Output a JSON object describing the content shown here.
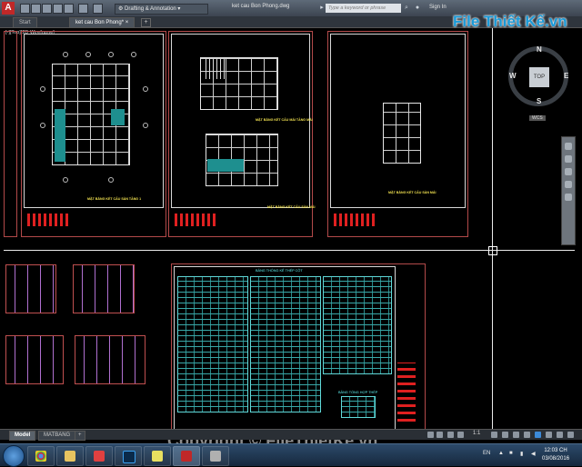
{
  "titlebar": {
    "app_logo": "A",
    "workspace": "Drafting & Annotation",
    "document_title": "ket cau Bon Phong.dwg",
    "search_placeholder": "Type a keyword or phrase",
    "sign_in": "Sign In"
  },
  "file_tabs": [
    {
      "label": "Start"
    },
    {
      "label": "ket cau Bon Phong*"
    }
  ],
  "viewport": {
    "label": "[-][Top][2D Wireframe]"
  },
  "drawings": {
    "caption_1": "MẶT BẰNG KẾT CẤU SÀN TẦNG 1",
    "caption_2a": "MẶT BẰNG KẾT CẤU MÁI TẦNG MÁI",
    "caption_2b": "MẶT BẰNG KẾT CẤU SÀN MÁI",
    "caption_3": "MẶT BẰNG KẾT CẤU SÀN MÁI",
    "table_title": "BẢNG THỐNG KÊ THÉP CỘT",
    "table_small_title": "BẢNG TỔNG HỢP THÉP"
  },
  "viewcube": {
    "top": "TOP",
    "north": "N",
    "south": "S",
    "east": "E",
    "west": "W",
    "wcs": "WCS"
  },
  "layout_tabs": [
    {
      "label": "Model"
    },
    {
      "label": "MATBANG"
    }
  ],
  "status": {
    "scale": "1:1"
  },
  "taskbar": {
    "language": "EN",
    "time": "12:03 CH",
    "date": "03/08/2016"
  },
  "watermark": {
    "text": "Copyright © FileThietKe.vn",
    "logo": "File Thiết Kế.vn"
  },
  "colors": {
    "sheet_border": "#b34a4a",
    "table_cyan": "#60d8d8",
    "accent_red": "#e02020",
    "caption_yellow": "#f0e050"
  }
}
